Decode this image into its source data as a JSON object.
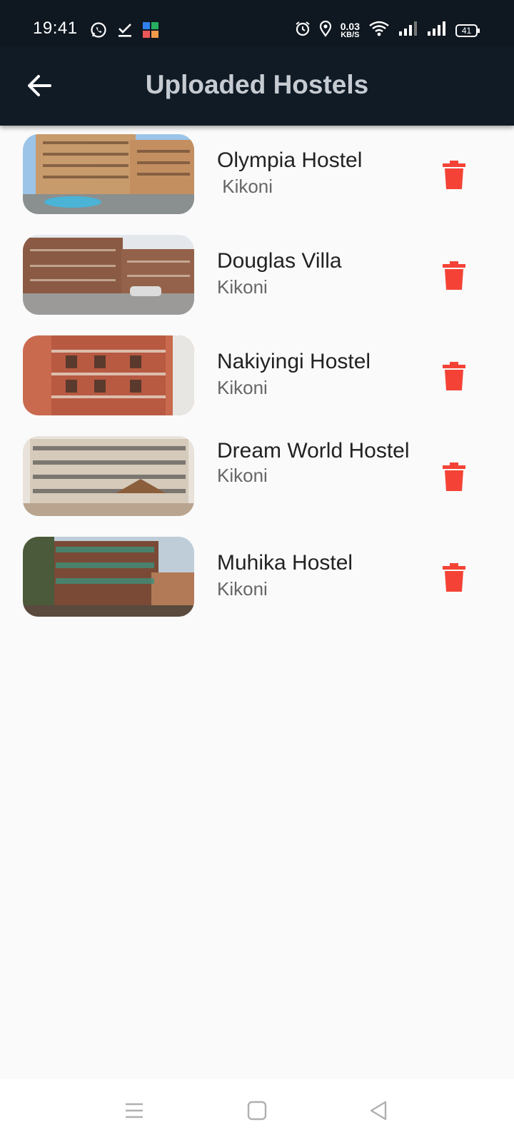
{
  "status_bar": {
    "time": "19:41",
    "net_speed_value": "0.03",
    "net_speed_unit": "KB/S",
    "battery": "41",
    "left_icons": [
      "whatsapp-icon",
      "checkmark-icon",
      "app-icon"
    ],
    "right_icons": [
      "alarm-icon",
      "location-icon",
      "wifi-icon",
      "signal-icon",
      "signal-icon",
      "battery-icon"
    ]
  },
  "app_bar": {
    "title": "Uploaded Hostels",
    "back_icon": "back-arrow-icon",
    "background": "#111b26"
  },
  "hostels": [
    {
      "name": "Olympia Hostel",
      "location": " Kikoni",
      "image": "hostel-photo"
    },
    {
      "name": "Douglas Villa",
      "location": "Kikoni",
      "image": "hostel-photo"
    },
    {
      "name": "Nakiyingi Hostel",
      "location": "Kikoni",
      "image": "hostel-photo"
    },
    {
      "name": "Dream World Hostel",
      "location": "Kikoni",
      "image": "hostel-photo"
    },
    {
      "name": "Muhika Hostel",
      "location": "Kikoni",
      "image": "hostel-photo"
    }
  ],
  "delete_icon": "trash-icon",
  "delete_color": "#f44336",
  "nav_bar": {
    "buttons": [
      "menu-icon",
      "home-square-icon",
      "back-triangle-icon"
    ]
  }
}
